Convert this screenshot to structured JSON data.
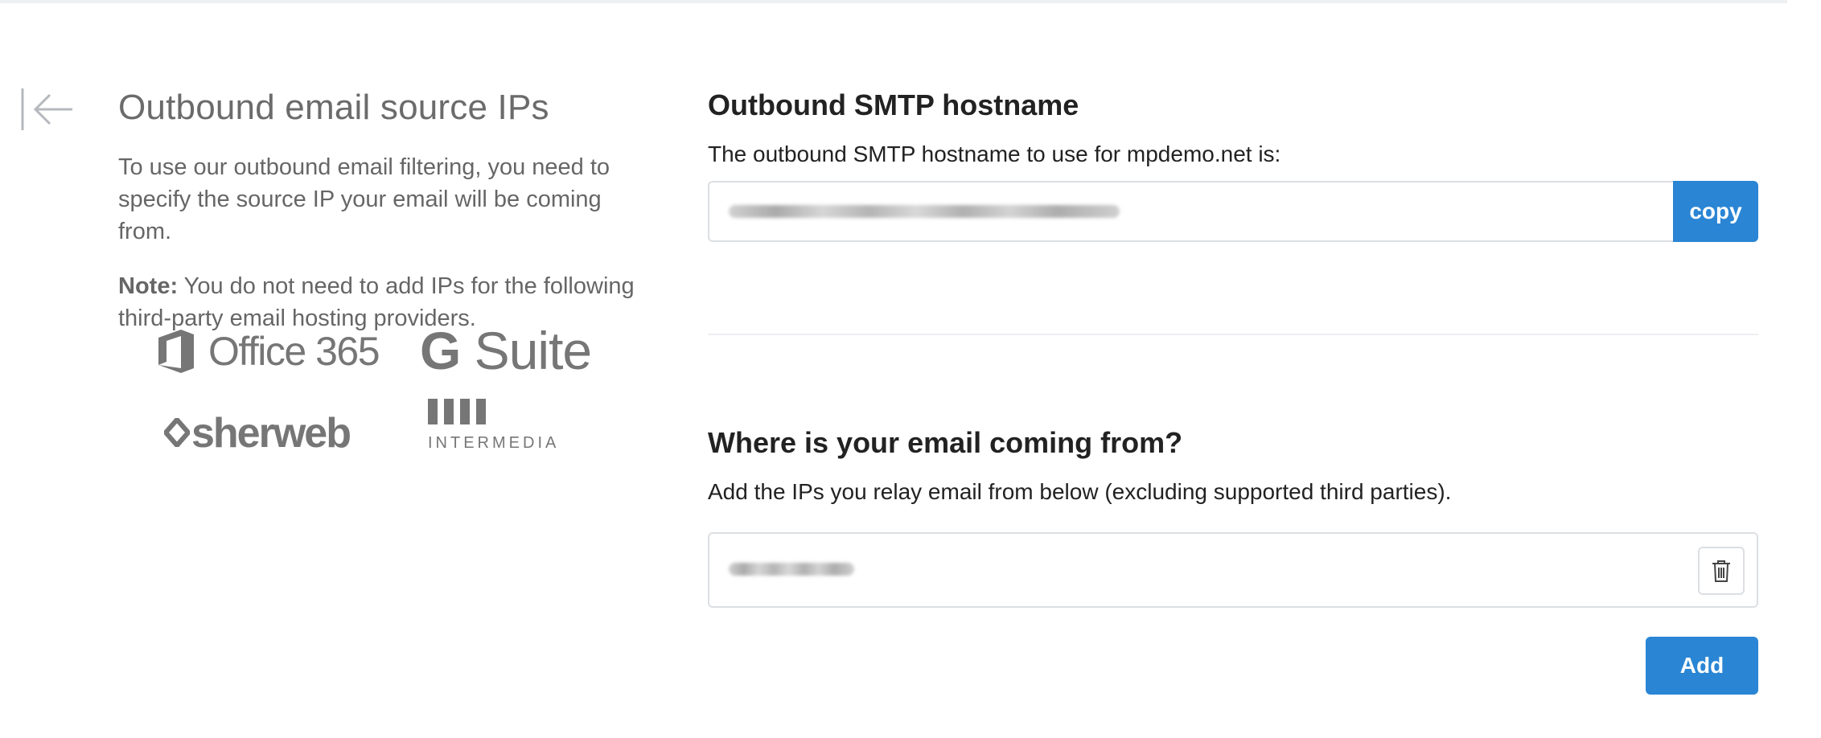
{
  "icons": {
    "back": "arrow-left-bar-icon",
    "office": "office-logo-icon",
    "sherweb": "sherweb-diamond-icon",
    "trash": "trash-icon"
  },
  "colors": {
    "accent": "#2a85d4",
    "muted_text": "#666666",
    "border": "#dcdfe3"
  },
  "sidebar": {
    "title": "Outbound email source IPs",
    "intro": "To use our outbound email filtering, you need to specify the source IP your email will be coming from.",
    "note_label": "Note:",
    "note_text": " You do not need to add IPs for the following third-party email hosting providers.",
    "providers": {
      "office365": "Office 365",
      "gsuite_g": "G",
      "gsuite_suite": " Suite",
      "sherweb": "sherweb",
      "intermedia": "INTERMEDIA"
    }
  },
  "smtp": {
    "heading": "Outbound SMTP hostname",
    "description": "The outbound SMTP hostname to use for mpdemo.net is:",
    "copy_label": "copy"
  },
  "source": {
    "heading": "Where is your email coming from?",
    "description": "Add the IPs you relay email from below (excluding supported third parties).",
    "add_label": "Add"
  }
}
